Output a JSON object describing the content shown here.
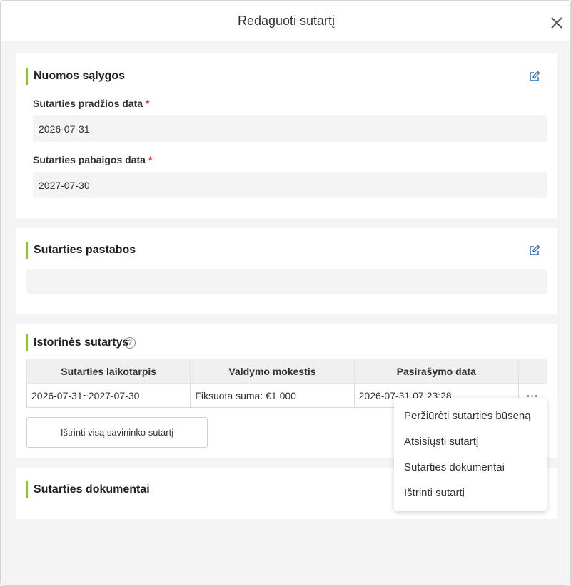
{
  "modal": {
    "title": "Redaguoti sutartį"
  },
  "rent_terms": {
    "title": "Nuomos sąlygos",
    "start_label": "Sutarties pradžios data",
    "start_value": "2026-07-31",
    "end_label": "Sutarties pabaigos data",
    "end_value": "2027-07-30",
    "required_mark": "*"
  },
  "notes": {
    "title": "Sutarties pastabos",
    "value": ""
  },
  "history": {
    "title": "Istorinės sutartys",
    "help_glyph": "?",
    "columns": [
      "Sutarties laikotarpis",
      "Valdymo mokestis",
      "Pasirašymo data"
    ],
    "rows": [
      {
        "period": "2026-07-31~2027-07-30",
        "fee": "Fiksuota suma: €1 000",
        "signed": "2026-07-31 07:23:28",
        "more": "···"
      }
    ],
    "delete_all_label": "Ištrinti visą savininko sutartį"
  },
  "documents": {
    "title": "Sutarties dokumentai"
  },
  "row_menu": {
    "items": [
      "Peržiūrėti sutarties būseną",
      "Atsisiųsti sutartį",
      "Sutarties dokumentai",
      "Ištrinti sutartį"
    ]
  },
  "colors": {
    "accent_bar": "#8cc63f",
    "edit_icon": "#2f6fba",
    "required": "#e02020"
  }
}
